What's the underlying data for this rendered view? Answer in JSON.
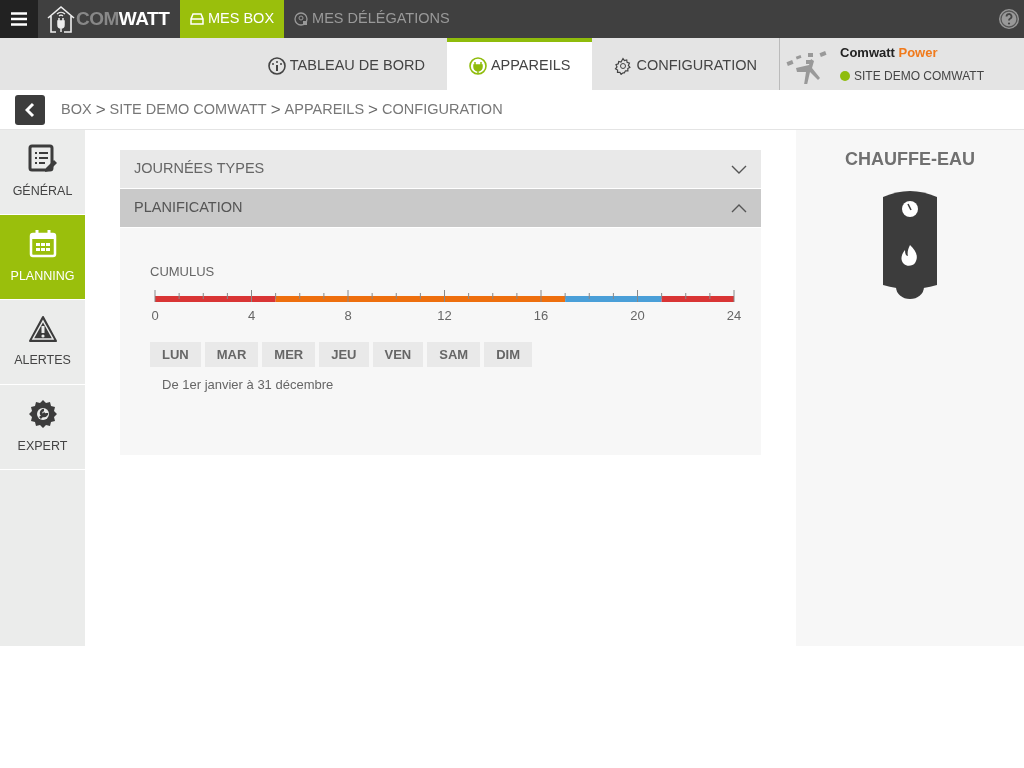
{
  "top_bar": {
    "logo": {
      "light": "COM",
      "bold": "WATT"
    },
    "tabs": [
      {
        "label": "MES BOX",
        "selected": true
      },
      {
        "label": "MES DÉLÉGATIONS",
        "selected": false
      }
    ]
  },
  "nav_tabs": [
    {
      "label": "TABLEAU DE BORD",
      "selected": false
    },
    {
      "label": "APPAREILS",
      "selected": true
    },
    {
      "label": "CONFIGURATION",
      "selected": false
    }
  ],
  "account": {
    "brand": "Comwatt",
    "brand_accent": "Power",
    "site": "SITE DEMO COMWATT"
  },
  "breadcrumb": [
    {
      "kind": "link",
      "text": "BOX"
    },
    {
      "kind": "separator",
      "text": ">"
    },
    {
      "kind": "link",
      "text": "SITE DEMO COMWATT"
    },
    {
      "kind": "separator",
      "text": ">"
    },
    {
      "kind": "link",
      "text": "APPAREILS"
    },
    {
      "kind": "separator",
      "text": ">"
    },
    {
      "kind": "link",
      "text": "CONFIGURATION"
    }
  ],
  "sidebar": {
    "items": [
      {
        "label": "GÉNÉRAL",
        "selected": false
      },
      {
        "label": "PLANNING",
        "selected": true
      },
      {
        "label": "ALERTES",
        "selected": false
      },
      {
        "label": "EXPERT",
        "selected": false
      }
    ]
  },
  "sections": [
    {
      "title": "JOURNÉES TYPES",
      "expanded": false
    },
    {
      "title": "PLANIFICATION",
      "expanded": true
    }
  ],
  "planning": {
    "chart_data": {
      "type": "bar",
      "orientation": "horizontal",
      "stacked": true,
      "grid": true,
      "title": "CUMULUS",
      "xlim": [
        0,
        24
      ],
      "xticks": [
        0,
        4,
        8,
        12,
        16,
        20,
        24
      ],
      "series": [
        {
          "color": "#d93535",
          "values": [
            5
          ]
        },
        {
          "color": "#ee6f0e",
          "values": [
            12
          ]
        },
        {
          "color": "#4a9fd8",
          "values": [
            4
          ]
        },
        {
          "color": "#d93535",
          "values": [
            3
          ]
        }
      ]
    },
    "days": [
      "LUN",
      "MAR",
      "MER",
      "JEU",
      "VEN",
      "SAM",
      "DIM"
    ],
    "period": "De 1er janvier à 31 décembre"
  },
  "device": {
    "title": "CHAUFFE-EAU"
  }
}
